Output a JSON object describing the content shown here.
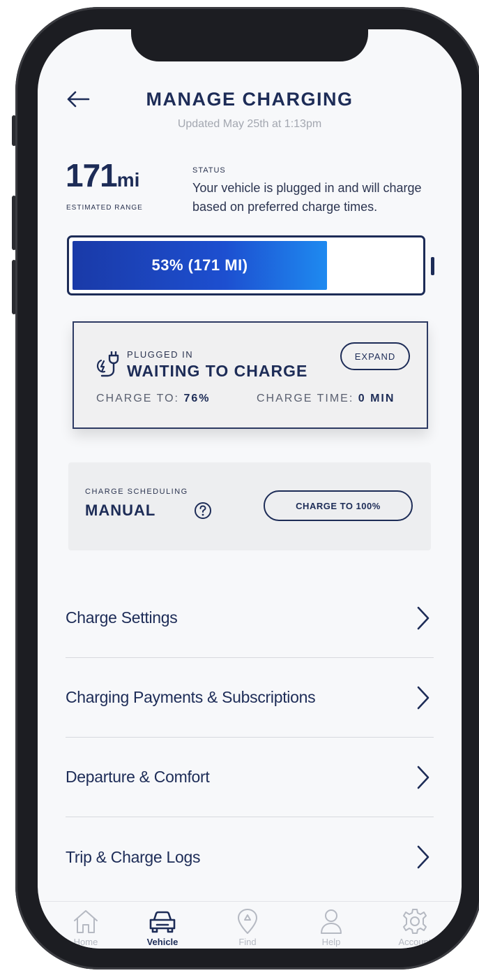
{
  "header": {
    "title": "MANAGE CHARGING",
    "updated": "Updated May 25th at 1:13pm"
  },
  "range": {
    "value": "171",
    "unit": "mi",
    "label": "ESTIMATED RANGE"
  },
  "status": {
    "label": "STATUS",
    "text": "Your vehicle is plugged in and will charge based on preferred charge times."
  },
  "battery": {
    "label": "53% (171 MI)",
    "percent": 53
  },
  "charge_card": {
    "plugged_label": "PLUGGED IN",
    "state": "WAITING TO CHARGE",
    "expand_label": "EXPAND",
    "charge_to_label": "CHARGE TO:",
    "charge_to_value": "76%",
    "charge_time_label": "CHARGE TIME:",
    "charge_time_value": "0 MIN"
  },
  "scheduling": {
    "label": "CHARGE SCHEDULING",
    "value": "MANUAL",
    "button_label": "CHARGE TO 100%"
  },
  "menu": [
    {
      "label": "Charge Settings"
    },
    {
      "label": "Charging Payments & Subscriptions"
    },
    {
      "label": "Departure & Comfort"
    },
    {
      "label": "Trip & Charge Logs"
    }
  ],
  "tabs": [
    {
      "label": "Home",
      "icon": "home-icon"
    },
    {
      "label": "Vehicle",
      "icon": "car-icon"
    },
    {
      "label": "Find",
      "icon": "location-pin-icon"
    },
    {
      "label": "Help",
      "icon": "person-icon"
    },
    {
      "label": "Account",
      "icon": "gear-icon"
    }
  ],
  "colors": {
    "primary": "#1d2c57",
    "battery_fill_start": "#1a3aa8",
    "battery_fill_end": "#1e8af0",
    "background": "#f7f8fa",
    "inactive_tab": "#b5b9c2"
  }
}
